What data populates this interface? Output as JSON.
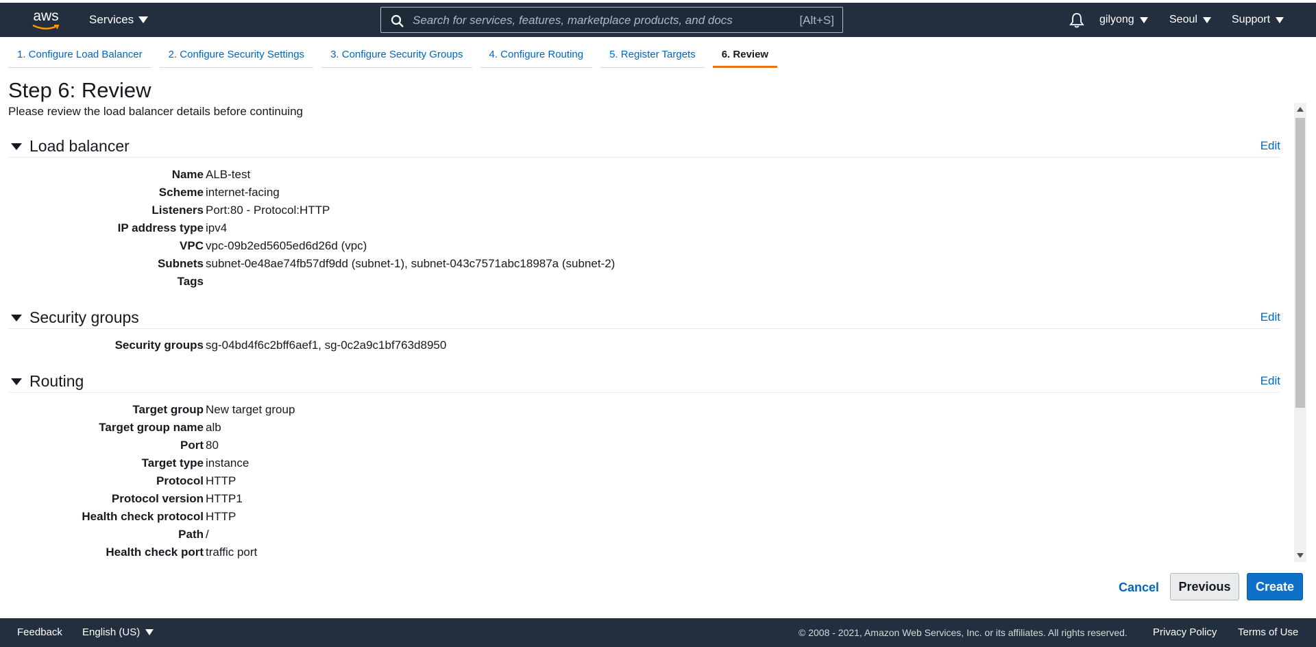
{
  "topnav": {
    "logo_text": "aws",
    "services_label": "Services",
    "search_placeholder": "Search for services, features, marketplace products, and docs",
    "search_shortcut": "[Alt+S]",
    "user": "gilyong",
    "region": "Seoul",
    "support": "Support"
  },
  "tabs": [
    {
      "label": "1. Configure Load Balancer",
      "active": false
    },
    {
      "label": "2. Configure Security Settings",
      "active": false
    },
    {
      "label": "3. Configure Security Groups",
      "active": false
    },
    {
      "label": "4. Configure Routing",
      "active": false
    },
    {
      "label": "5. Register Targets",
      "active": false
    },
    {
      "label": "6. Review",
      "active": true
    }
  ],
  "page": {
    "title": "Step 6: Review",
    "subtitle": "Please review the load balancer details before continuing"
  },
  "sections": {
    "load_balancer": {
      "title": "Load balancer",
      "edit": "Edit",
      "rows": [
        {
          "key": "Name",
          "value": "ALB-test"
        },
        {
          "key": "Scheme",
          "value": "internet-facing"
        },
        {
          "key": "Listeners",
          "value": "Port:80 - Protocol:HTTP"
        },
        {
          "key": "IP address type",
          "value": "ipv4"
        },
        {
          "key": "VPC",
          "value": "vpc-09b2ed5605ed6d26d (vpc)"
        },
        {
          "key": "Subnets",
          "value": "subnet-0e48ae74fb57df9dd (subnet-1), subnet-043c7571abc18987a (subnet-2)"
        },
        {
          "key": "Tags",
          "value": ""
        }
      ]
    },
    "security_groups": {
      "title": "Security groups",
      "edit": "Edit",
      "rows": [
        {
          "key": "Security groups",
          "value": "sg-04bd4f6c2bff6aef1, sg-0c2a9c1bf763d8950"
        }
      ]
    },
    "routing": {
      "title": "Routing",
      "edit": "Edit",
      "rows": [
        {
          "key": "Target group",
          "value": "New target group"
        },
        {
          "key": "Target group name",
          "value": "alb"
        },
        {
          "key": "Port",
          "value": "80"
        },
        {
          "key": "Target type",
          "value": "instance"
        },
        {
          "key": "Protocol",
          "value": "HTTP"
        },
        {
          "key": "Protocol version",
          "value": "HTTP1"
        },
        {
          "key": "Health check protocol",
          "value": "HTTP"
        },
        {
          "key": "Path",
          "value": "/"
        },
        {
          "key": "Health check port",
          "value": "traffic port"
        }
      ]
    }
  },
  "actions": {
    "cancel": "Cancel",
    "previous": "Previous",
    "create": "Create"
  },
  "footer": {
    "feedback": "Feedback",
    "language": "English (US)",
    "copyright": "© 2008 - 2021, Amazon Web Services, Inc. or its affiliates. All rights reserved.",
    "privacy": "Privacy Policy",
    "terms": "Terms of Use"
  },
  "colors": {
    "nav_bg": "#232f3e",
    "link": "#0066c0",
    "active_tab": "#ec7211",
    "primary_button": "#0f70c8"
  }
}
